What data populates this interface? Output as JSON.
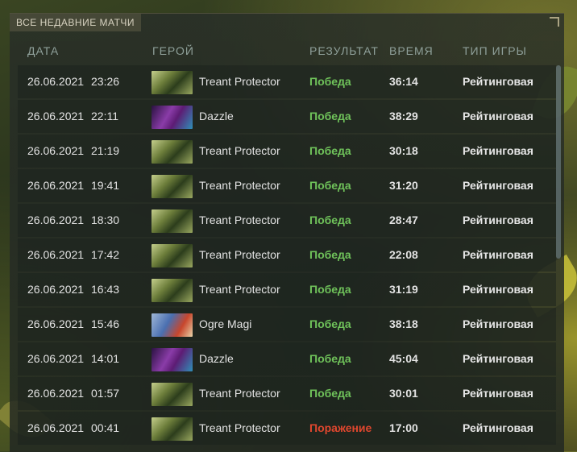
{
  "panel": {
    "title": "ВСЕ НЕДАВНИЕ МАТЧИ"
  },
  "columns": {
    "date": "ДАТА",
    "hero": "ГЕРОЙ",
    "result": "РЕЗУЛЬТАТ",
    "duration": "ВРЕМЯ",
    "game_type": "ТИП ИГРЫ"
  },
  "colors": {
    "win": "#6fc25a",
    "loss": "#e0472e"
  },
  "matches": [
    {
      "date": "26.06.2021",
      "time": "23:26",
      "hero": "Treant Protector",
      "hero_icon": "treant-portrait",
      "result": "Победа",
      "outcome": "win",
      "duration": "36:14",
      "game_type": "Рейтинговая"
    },
    {
      "date": "26.06.2021",
      "time": "22:11",
      "hero": "Dazzle",
      "hero_icon": "dazzle-portrait",
      "result": "Победа",
      "outcome": "win",
      "duration": "38:29",
      "game_type": "Рейтинговая"
    },
    {
      "date": "26.06.2021",
      "time": "21:19",
      "hero": "Treant Protector",
      "hero_icon": "treant-portrait",
      "result": "Победа",
      "outcome": "win",
      "duration": "30:18",
      "game_type": "Рейтинговая"
    },
    {
      "date": "26.06.2021",
      "time": "19:41",
      "hero": "Treant Protector",
      "hero_icon": "treant-portrait",
      "result": "Победа",
      "outcome": "win",
      "duration": "31:20",
      "game_type": "Рейтинговая"
    },
    {
      "date": "26.06.2021",
      "time": "18:30",
      "hero": "Treant Protector",
      "hero_icon": "treant-portrait",
      "result": "Победа",
      "outcome": "win",
      "duration": "28:47",
      "game_type": "Рейтинговая"
    },
    {
      "date": "26.06.2021",
      "time": "17:42",
      "hero": "Treant Protector",
      "hero_icon": "treant-portrait",
      "result": "Победа",
      "outcome": "win",
      "duration": "22:08",
      "game_type": "Рейтинговая"
    },
    {
      "date": "26.06.2021",
      "time": "16:43",
      "hero": "Treant Protector",
      "hero_icon": "treant-portrait",
      "result": "Победа",
      "outcome": "win",
      "duration": "31:19",
      "game_type": "Рейтинговая"
    },
    {
      "date": "26.06.2021",
      "time": "15:46",
      "hero": "Ogre Magi",
      "hero_icon": "ogre-magi-portrait",
      "result": "Победа",
      "outcome": "win",
      "duration": "38:18",
      "game_type": "Рейтинговая"
    },
    {
      "date": "26.06.2021",
      "time": "14:01",
      "hero": "Dazzle",
      "hero_icon": "dazzle-portrait",
      "result": "Победа",
      "outcome": "win",
      "duration": "45:04",
      "game_type": "Рейтинговая"
    },
    {
      "date": "26.06.2021",
      "time": "01:57",
      "hero": "Treant Protector",
      "hero_icon": "treant-portrait",
      "result": "Победа",
      "outcome": "win",
      "duration": "30:01",
      "game_type": "Рейтинговая"
    },
    {
      "date": "26.06.2021",
      "time": "00:41",
      "hero": "Treant Protector",
      "hero_icon": "treant-portrait",
      "result": "Поражение",
      "outcome": "loss",
      "duration": "17:00",
      "game_type": "Рейтинговая"
    }
  ]
}
